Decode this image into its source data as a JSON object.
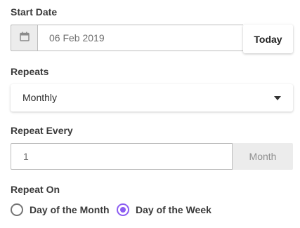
{
  "start_date": {
    "label": "Start Date",
    "value": "06 Feb 2019",
    "icon": "calendar-icon",
    "today_label": "Today"
  },
  "repeats": {
    "label": "Repeats",
    "selected": "Monthly"
  },
  "repeat_every": {
    "label": "Repeat Every",
    "value": "1",
    "unit": "Month"
  },
  "repeat_on": {
    "label": "Repeat On",
    "options": [
      {
        "label": "Day of the Month",
        "checked": false
      },
      {
        "label": "Day of the Week",
        "checked": true
      }
    ],
    "accent_color": "#8c5df2"
  }
}
